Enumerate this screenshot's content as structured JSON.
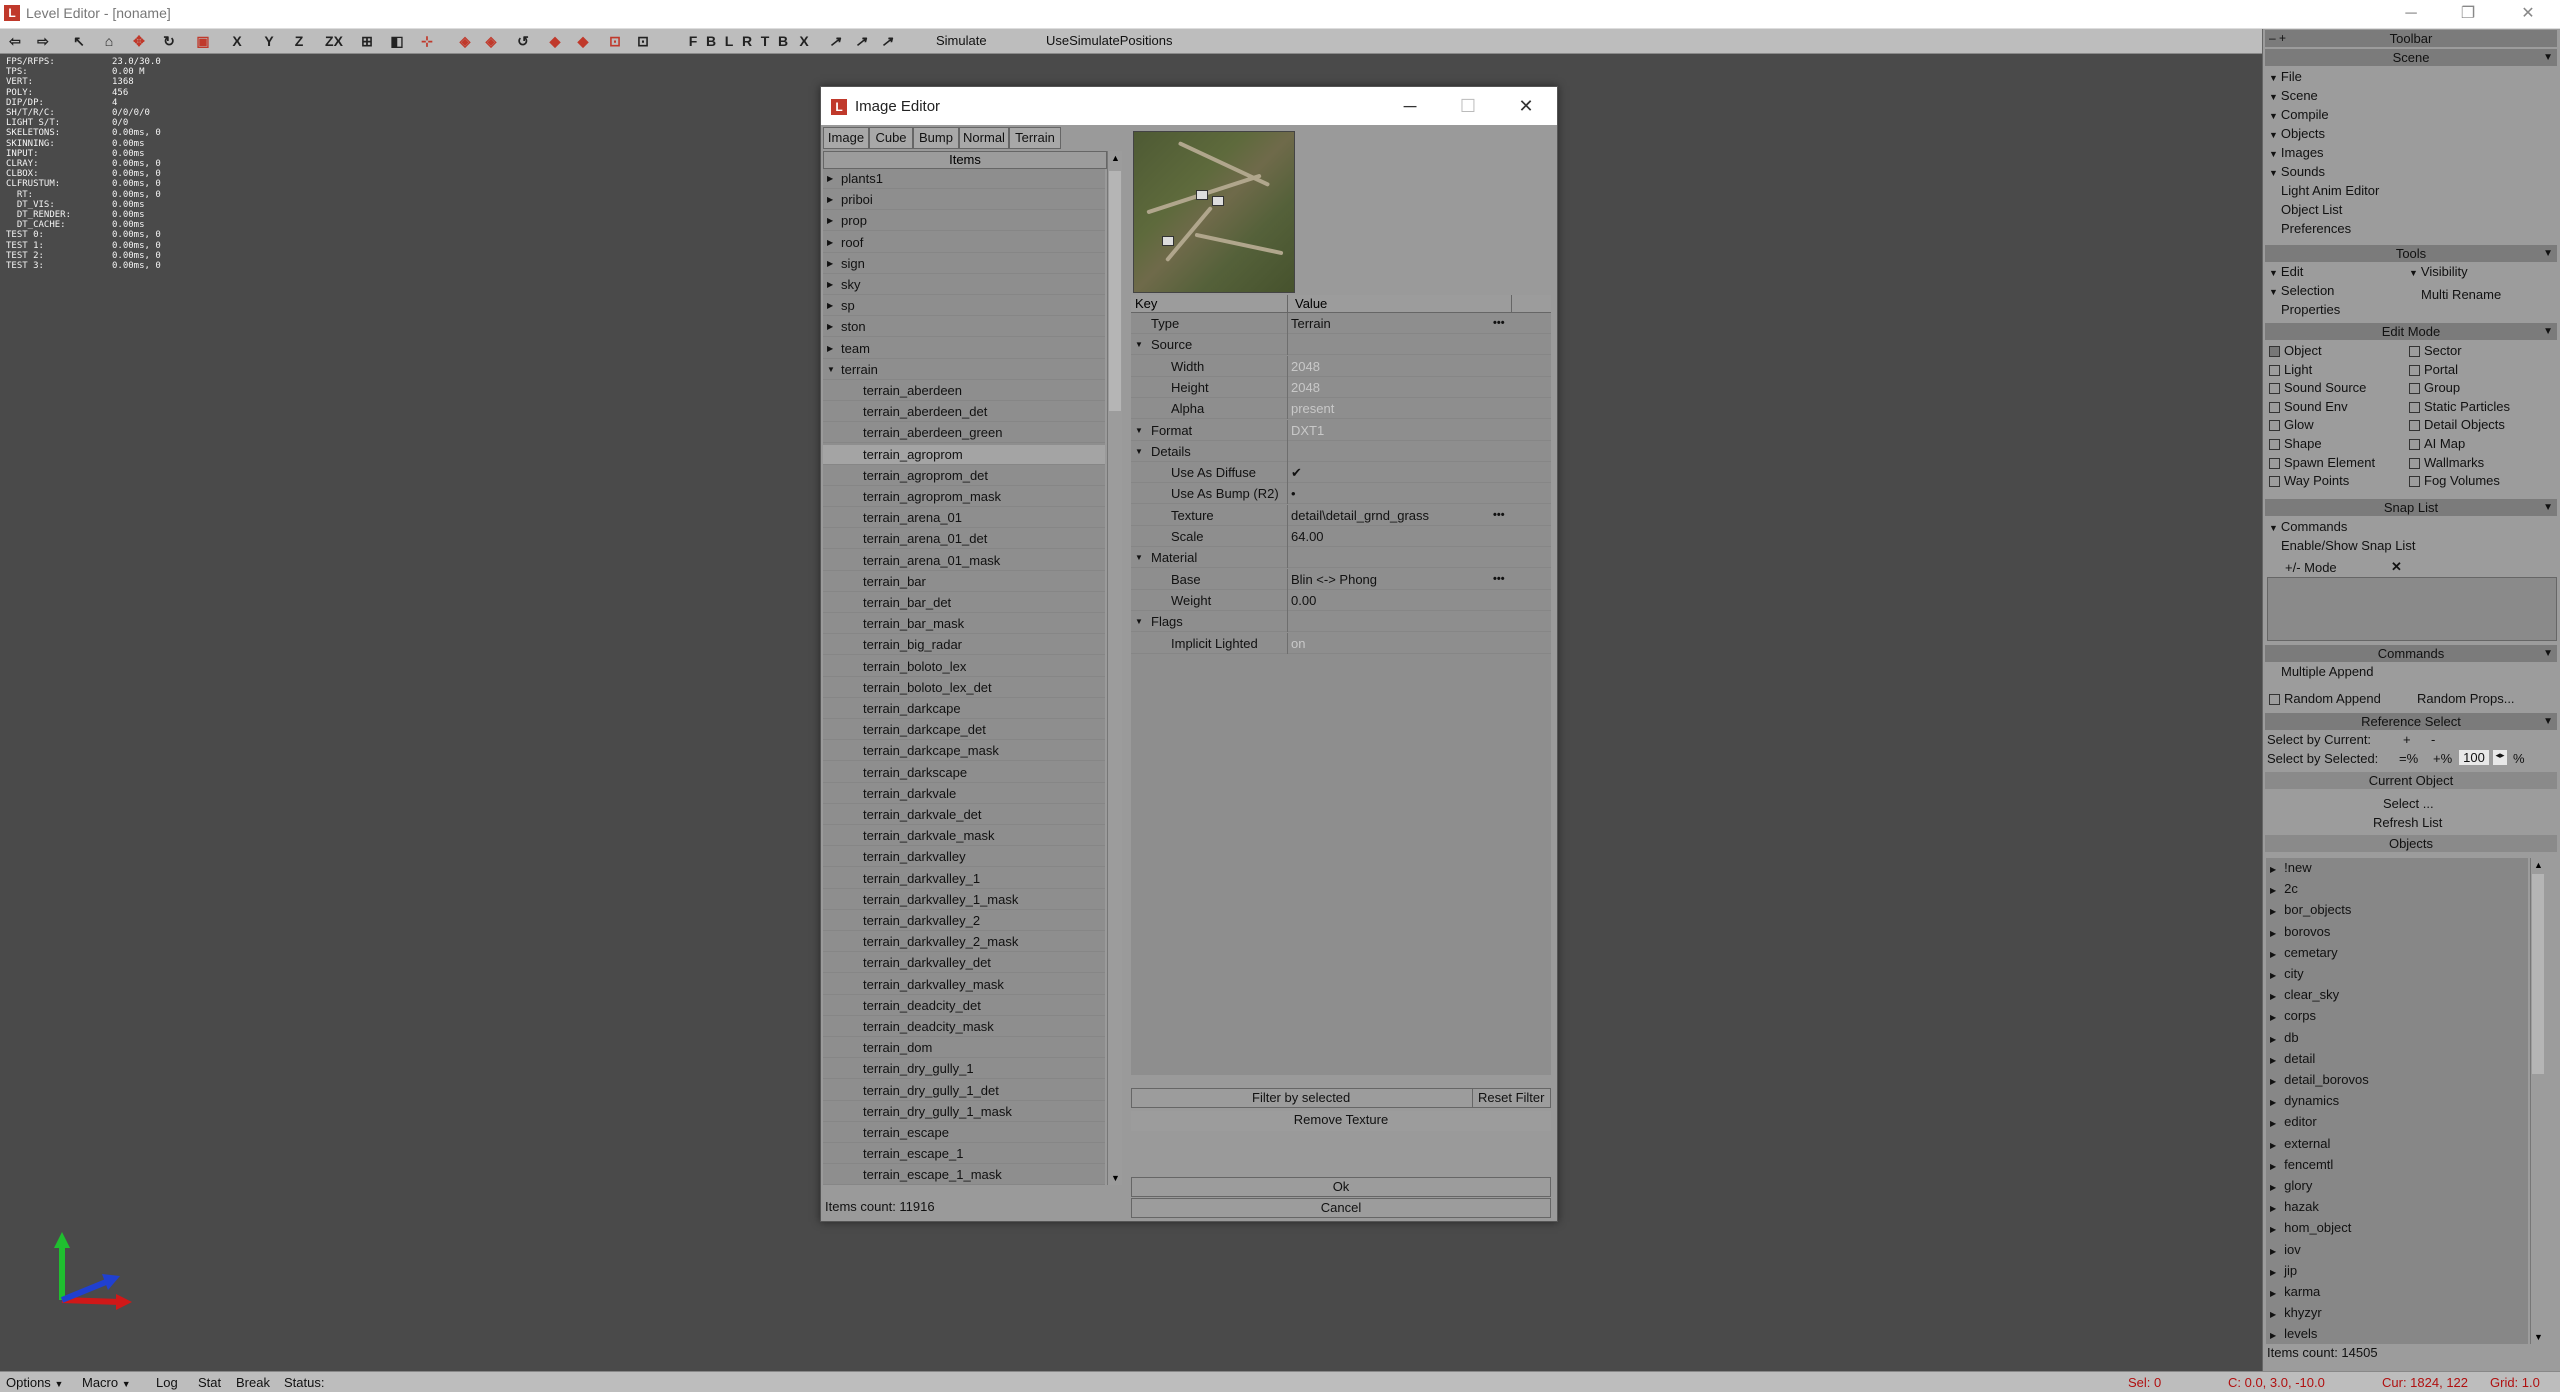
{
  "window": {
    "title": "Level Editor - [noname]",
    "min": "─",
    "max": "❐",
    "close": "✕"
  },
  "toolbar": {
    "axes": [
      "X",
      "Y",
      "Z",
      "ZX"
    ],
    "letters": [
      "F",
      "B",
      "L",
      "R",
      "T",
      "B",
      "X"
    ],
    "simulate": "Simulate",
    "use_sim": "UseSimulatePositions"
  },
  "stats": [
    {
      "k": "FPS/RFPS:",
      "v": "23.0/30.0"
    },
    {
      "k": "TPS:",
      "v": "0.00 M"
    },
    {
      "k": "VERT:",
      "v": "1368"
    },
    {
      "k": "POLY:",
      "v": "456"
    },
    {
      "k": "DIP/DP:",
      "v": "4"
    },
    {
      "k": "SH/T/R/C:",
      "v": "0/0/0/0"
    },
    {
      "k": "LIGHT S/T:",
      "v": "0/0"
    },
    {
      "k": "SKELETONS:",
      "v": "0.00ms, 0"
    },
    {
      "k": "SKINNING:",
      "v": "0.00ms"
    },
    {
      "k": "",
      "v": ""
    },
    {
      "k": "INPUT:",
      "v": "0.00ms"
    },
    {
      "k": "CLRAY:",
      "v": "0.00ms, 0"
    },
    {
      "k": "CLBOX:",
      "v": "0.00ms, 0"
    },
    {
      "k": "CLFRUSTUM:",
      "v": "0.00ms, 0"
    },
    {
      "k": "",
      "v": ""
    },
    {
      "k": "  RT:",
      "v": "0.00ms, 0"
    },
    {
      "k": "  DT_VIS:",
      "v": "0.00ms"
    },
    {
      "k": "  DT_RENDER:",
      "v": "0.00ms"
    },
    {
      "k": "  DT_CACHE:",
      "v": "0.00ms"
    },
    {
      "k": "",
      "v": ""
    },
    {
      "k": "TEST 0:",
      "v": "0.00ms, 0"
    },
    {
      "k": "TEST 1:",
      "v": "0.00ms, 0"
    },
    {
      "k": "TEST 2:",
      "v": "0.00ms, 0"
    },
    {
      "k": "TEST 3:",
      "v": "0.00ms, 0"
    }
  ],
  "dialog": {
    "title": "Image Editor",
    "tabs": [
      "Image",
      "Cube",
      "Bump",
      "Normal",
      "Terrain"
    ],
    "items_header": "Items",
    "items": [
      {
        "label": "plants1",
        "type": "folder"
      },
      {
        "label": "priboi",
        "type": "folder"
      },
      {
        "label": "prop",
        "type": "folder"
      },
      {
        "label": "roof",
        "type": "folder"
      },
      {
        "label": "sign",
        "type": "folder"
      },
      {
        "label": "sky",
        "type": "folder"
      },
      {
        "label": "sp",
        "type": "folder"
      },
      {
        "label": "ston",
        "type": "folder"
      },
      {
        "label": "team",
        "type": "folder"
      },
      {
        "label": "terrain",
        "type": "open"
      },
      {
        "label": "terrain_aberdeen",
        "type": "leaf"
      },
      {
        "label": "terrain_aberdeen_det",
        "type": "leaf"
      },
      {
        "label": "terrain_aberdeen_green",
        "type": "leaf"
      },
      {
        "label": "terrain_agroprom",
        "type": "sel"
      },
      {
        "label": "terrain_agroprom_det",
        "type": "leaf"
      },
      {
        "label": "terrain_agroprom_mask",
        "type": "leaf"
      },
      {
        "label": "terrain_arena_01",
        "type": "leaf"
      },
      {
        "label": "terrain_arena_01_det",
        "type": "leaf"
      },
      {
        "label": "terrain_arena_01_mask",
        "type": "leaf"
      },
      {
        "label": "terrain_bar",
        "type": "leaf"
      },
      {
        "label": "terrain_bar_det",
        "type": "leaf"
      },
      {
        "label": "terrain_bar_mask",
        "type": "leaf"
      },
      {
        "label": "terrain_big_radar",
        "type": "leaf"
      },
      {
        "label": "terrain_boloto_lex",
        "type": "leaf"
      },
      {
        "label": "terrain_boloto_lex_det",
        "type": "leaf"
      },
      {
        "label": "terrain_darkcape",
        "type": "leaf"
      },
      {
        "label": "terrain_darkcape_det",
        "type": "leaf"
      },
      {
        "label": "terrain_darkcape_mask",
        "type": "leaf"
      },
      {
        "label": "terrain_darkscape",
        "type": "leaf"
      },
      {
        "label": "terrain_darkvale",
        "type": "leaf"
      },
      {
        "label": "terrain_darkvale_det",
        "type": "leaf"
      },
      {
        "label": "terrain_darkvale_mask",
        "type": "leaf"
      },
      {
        "label": "terrain_darkvalley",
        "type": "leaf"
      },
      {
        "label": "terrain_darkvalley_1",
        "type": "leaf"
      },
      {
        "label": "terrain_darkvalley_1_mask",
        "type": "leaf"
      },
      {
        "label": "terrain_darkvalley_2",
        "type": "leaf"
      },
      {
        "label": "terrain_darkvalley_2_mask",
        "type": "leaf"
      },
      {
        "label": "terrain_darkvalley_det",
        "type": "leaf"
      },
      {
        "label": "terrain_darkvalley_mask",
        "type": "leaf"
      },
      {
        "label": "terrain_deadcity_det",
        "type": "leaf"
      },
      {
        "label": "terrain_deadcity_mask",
        "type": "leaf"
      },
      {
        "label": "terrain_dom",
        "type": "leaf"
      },
      {
        "label": "terrain_dry_gully_1",
        "type": "leaf"
      },
      {
        "label": "terrain_dry_gully_1_det",
        "type": "leaf"
      },
      {
        "label": "terrain_dry_gully_1_mask",
        "type": "leaf"
      },
      {
        "label": "terrain_escape",
        "type": "leaf"
      },
      {
        "label": "terrain_escape_1",
        "type": "leaf"
      },
      {
        "label": "terrain_escape_1_mask",
        "type": "leaf"
      }
    ],
    "items_count": "Items count: 11916",
    "props_header": {
      "key": "Key",
      "value": "Value"
    },
    "props": [
      {
        "k": "Type",
        "v": "Terrain",
        "lvl": 1,
        "dots": true
      },
      {
        "k": "Source",
        "v": "",
        "lvl": 0
      },
      {
        "k": "Width",
        "v": "2048",
        "lvl": 1,
        "grey": true
      },
      {
        "k": "Height",
        "v": "2048",
        "lvl": 1,
        "grey": true
      },
      {
        "k": "Alpha",
        "v": "present",
        "lvl": 1,
        "grey": true
      },
      {
        "k": "Format",
        "v": "DXT1",
        "lvl": 0,
        "grey": true
      },
      {
        "k": "Details",
        "v": "",
        "lvl": 0
      },
      {
        "k": "Use As Diffuse",
        "v": "✔",
        "lvl": 1
      },
      {
        "k": "Use As Bump (R2)",
        "v": "•",
        "lvl": 1
      },
      {
        "k": "Texture",
        "v": "detail\\detail_grnd_grass",
        "lvl": 1,
        "dots": true
      },
      {
        "k": "Scale",
        "v": "64.00",
        "lvl": 1
      },
      {
        "k": "Material",
        "v": "",
        "lvl": 0
      },
      {
        "k": "Base",
        "v": "Blin <-> Phong",
        "lvl": 1,
        "dots": true
      },
      {
        "k": "Weight",
        "v": "0.00",
        "lvl": 1
      },
      {
        "k": "Flags",
        "v": "",
        "lvl": 0
      },
      {
        "k": "Implicit Lighted",
        "v": "on",
        "lvl": 1,
        "grey": true
      }
    ],
    "filter_by_selected": "Filter by selected",
    "reset_filter": "Reset Filter",
    "remove_texture": "Remove Texture",
    "ok": "Ok",
    "cancel": "Cancel"
  },
  "right": {
    "toolbar_title": "Toolbar",
    "scene_title": "Scene",
    "scene_items": [
      "File",
      "Scene",
      "Compile",
      "Objects",
      "Images",
      "Sounds"
    ],
    "scene_links": [
      "Light Anim Editor",
      "Object List",
      "Preferences"
    ],
    "tools_title": "Tools",
    "tools": {
      "edit": "Edit",
      "visibility": "Visibility",
      "selection": "Selection",
      "multi_rename": "Multi Rename",
      "properties": "Properties"
    },
    "editmode_title": "Edit Mode",
    "editmode_left": [
      "Object",
      "Light",
      "Sound Source",
      "Sound Env",
      "Glow",
      "Shape",
      "Spawn Element",
      "Way Points"
    ],
    "editmode_right": [
      "Sector",
      "Portal",
      "Group",
      "Static Particles",
      "Detail Objects",
      "AI Map",
      "Wallmarks",
      "Fog Volumes"
    ],
    "snaplist_title": "Snap List",
    "commands_label": "Commands",
    "enable_snap": "Enable/Show Snap List",
    "mode_label": "+/- Mode",
    "commands_title": "Commands",
    "multiple_append": "Multiple Append",
    "random_append": "Random Append",
    "random_props": "Random Props...",
    "refselect_title": "Reference Select",
    "select_by_current": "Select by Current:",
    "select_by_selected": "Select by Selected:",
    "plus": "+",
    "minus": "-",
    "eqpct": "=%",
    "pluspct": "+%",
    "pct_value": "100",
    "pct": "%",
    "curobj_title": "Current Object",
    "select": "Select ...",
    "refresh": "Refresh List",
    "objects_title": "Objects",
    "objects": [
      "!new",
      "2c",
      "bor_objects",
      "borovos",
      "cemetary",
      "city",
      "clear_sky",
      "corps",
      "db",
      "detail",
      "detail_borovos",
      "dynamics",
      "editor",
      "external",
      "fencemtl",
      "glory",
      "hazak",
      "hom_object",
      "iov",
      "jip",
      "karma",
      "khyzyr",
      "levels"
    ],
    "objects_count": "Items count: 14505"
  },
  "status": {
    "options": "Options",
    "macro": "Macro",
    "log": "Log",
    "stat": "Stat",
    "break": "Break",
    "status": "Status:",
    "sel": "Sel: 0",
    "c": "C: 0.0, 3.0, -10.0",
    "cur": "Cur: 1824, 122",
    "grid": "Grid: 1.0"
  }
}
